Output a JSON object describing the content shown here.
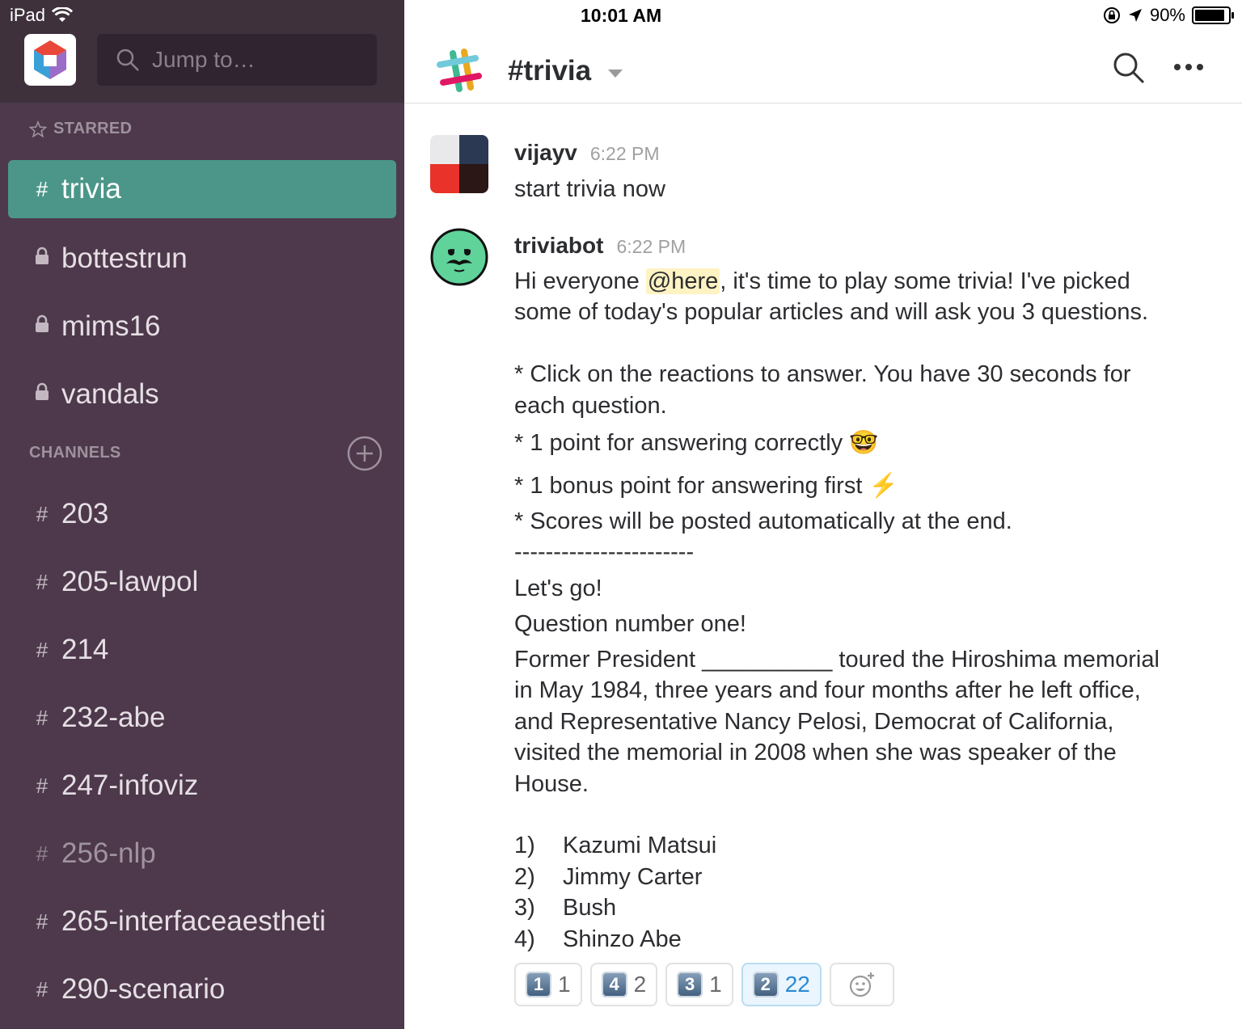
{
  "status_bar": {
    "device": "iPad",
    "time": "10:01 AM",
    "battery": "90%",
    "battery_level": 0.9
  },
  "sidebar": {
    "search_placeholder": "Jump to…",
    "starred_label": "STARRED",
    "starred": [
      {
        "prefix": "#",
        "label": "trivia",
        "active": true
      },
      {
        "prefix": "lock",
        "label": "bottestrun"
      },
      {
        "prefix": "lock",
        "label": "mims16"
      },
      {
        "prefix": "lock",
        "label": "vandals"
      }
    ],
    "channels_label": "CHANNELS",
    "channels": [
      {
        "prefix": "#",
        "label": "203"
      },
      {
        "prefix": "#",
        "label": "205-lawpol"
      },
      {
        "prefix": "#",
        "label": "214"
      },
      {
        "prefix": "#",
        "label": "232-abe"
      },
      {
        "prefix": "#",
        "label": "247-infoviz"
      },
      {
        "prefix": "#",
        "label": "256-nlp",
        "muted": true
      },
      {
        "prefix": "#",
        "label": "265-interfaceaestheti"
      },
      {
        "prefix": "#",
        "label": "290-scenario"
      }
    ]
  },
  "header": {
    "channel_name": "#trivia"
  },
  "messages": [
    {
      "author": "vijayv",
      "time": "6:22 PM",
      "lines": [
        "start trivia now"
      ]
    },
    {
      "author": "triviabot",
      "time": "6:22 PM",
      "greeting_pre": "Hi everyone ",
      "mention": "@here",
      "greeting_post": ", it's time to play some trivia! I've picked",
      "lines": [
        "some of today's popular articles and will ask you 3 questions.",
        "* Click on the reactions to answer. You have 30 seconds for",
        "each question.",
        "* 1 point for answering correctly 🤓",
        "* 1 bonus point for answering first ⚡",
        "* Scores will be posted automatically at the end.",
        "-----------------------",
        "Let's go!",
        "Question number one!",
        "Former President __________ toured the Hiroshima memorial",
        "in May 1984, three years and four months after he left office,",
        "and Representative Nancy Pelosi, Democrat of California,",
        "visited the memorial in 2008 when she was speaker of the",
        "House."
      ],
      "options": [
        {
          "num": "1)",
          "text": "Kazumi Matsui"
        },
        {
          "num": "2)",
          "text": "Jimmy Carter"
        },
        {
          "num": "3)",
          "text": "Bush"
        },
        {
          "num": "4)",
          "text": "Shinzo Abe"
        }
      ]
    }
  ],
  "reactions": [
    {
      "emoji": "1",
      "count": "1"
    },
    {
      "emoji": "4",
      "count": "2"
    },
    {
      "emoji": "3",
      "count": "1"
    },
    {
      "emoji": "2",
      "count": "22",
      "mine": true
    }
  ],
  "colors": {
    "sidebar_bg": "#4d394b",
    "sidebar_top_bg": "#3e313c",
    "active_channel": "#4c9689",
    "mention_bg": "#fff3c3",
    "reaction_mine": "#2a8ad4"
  }
}
